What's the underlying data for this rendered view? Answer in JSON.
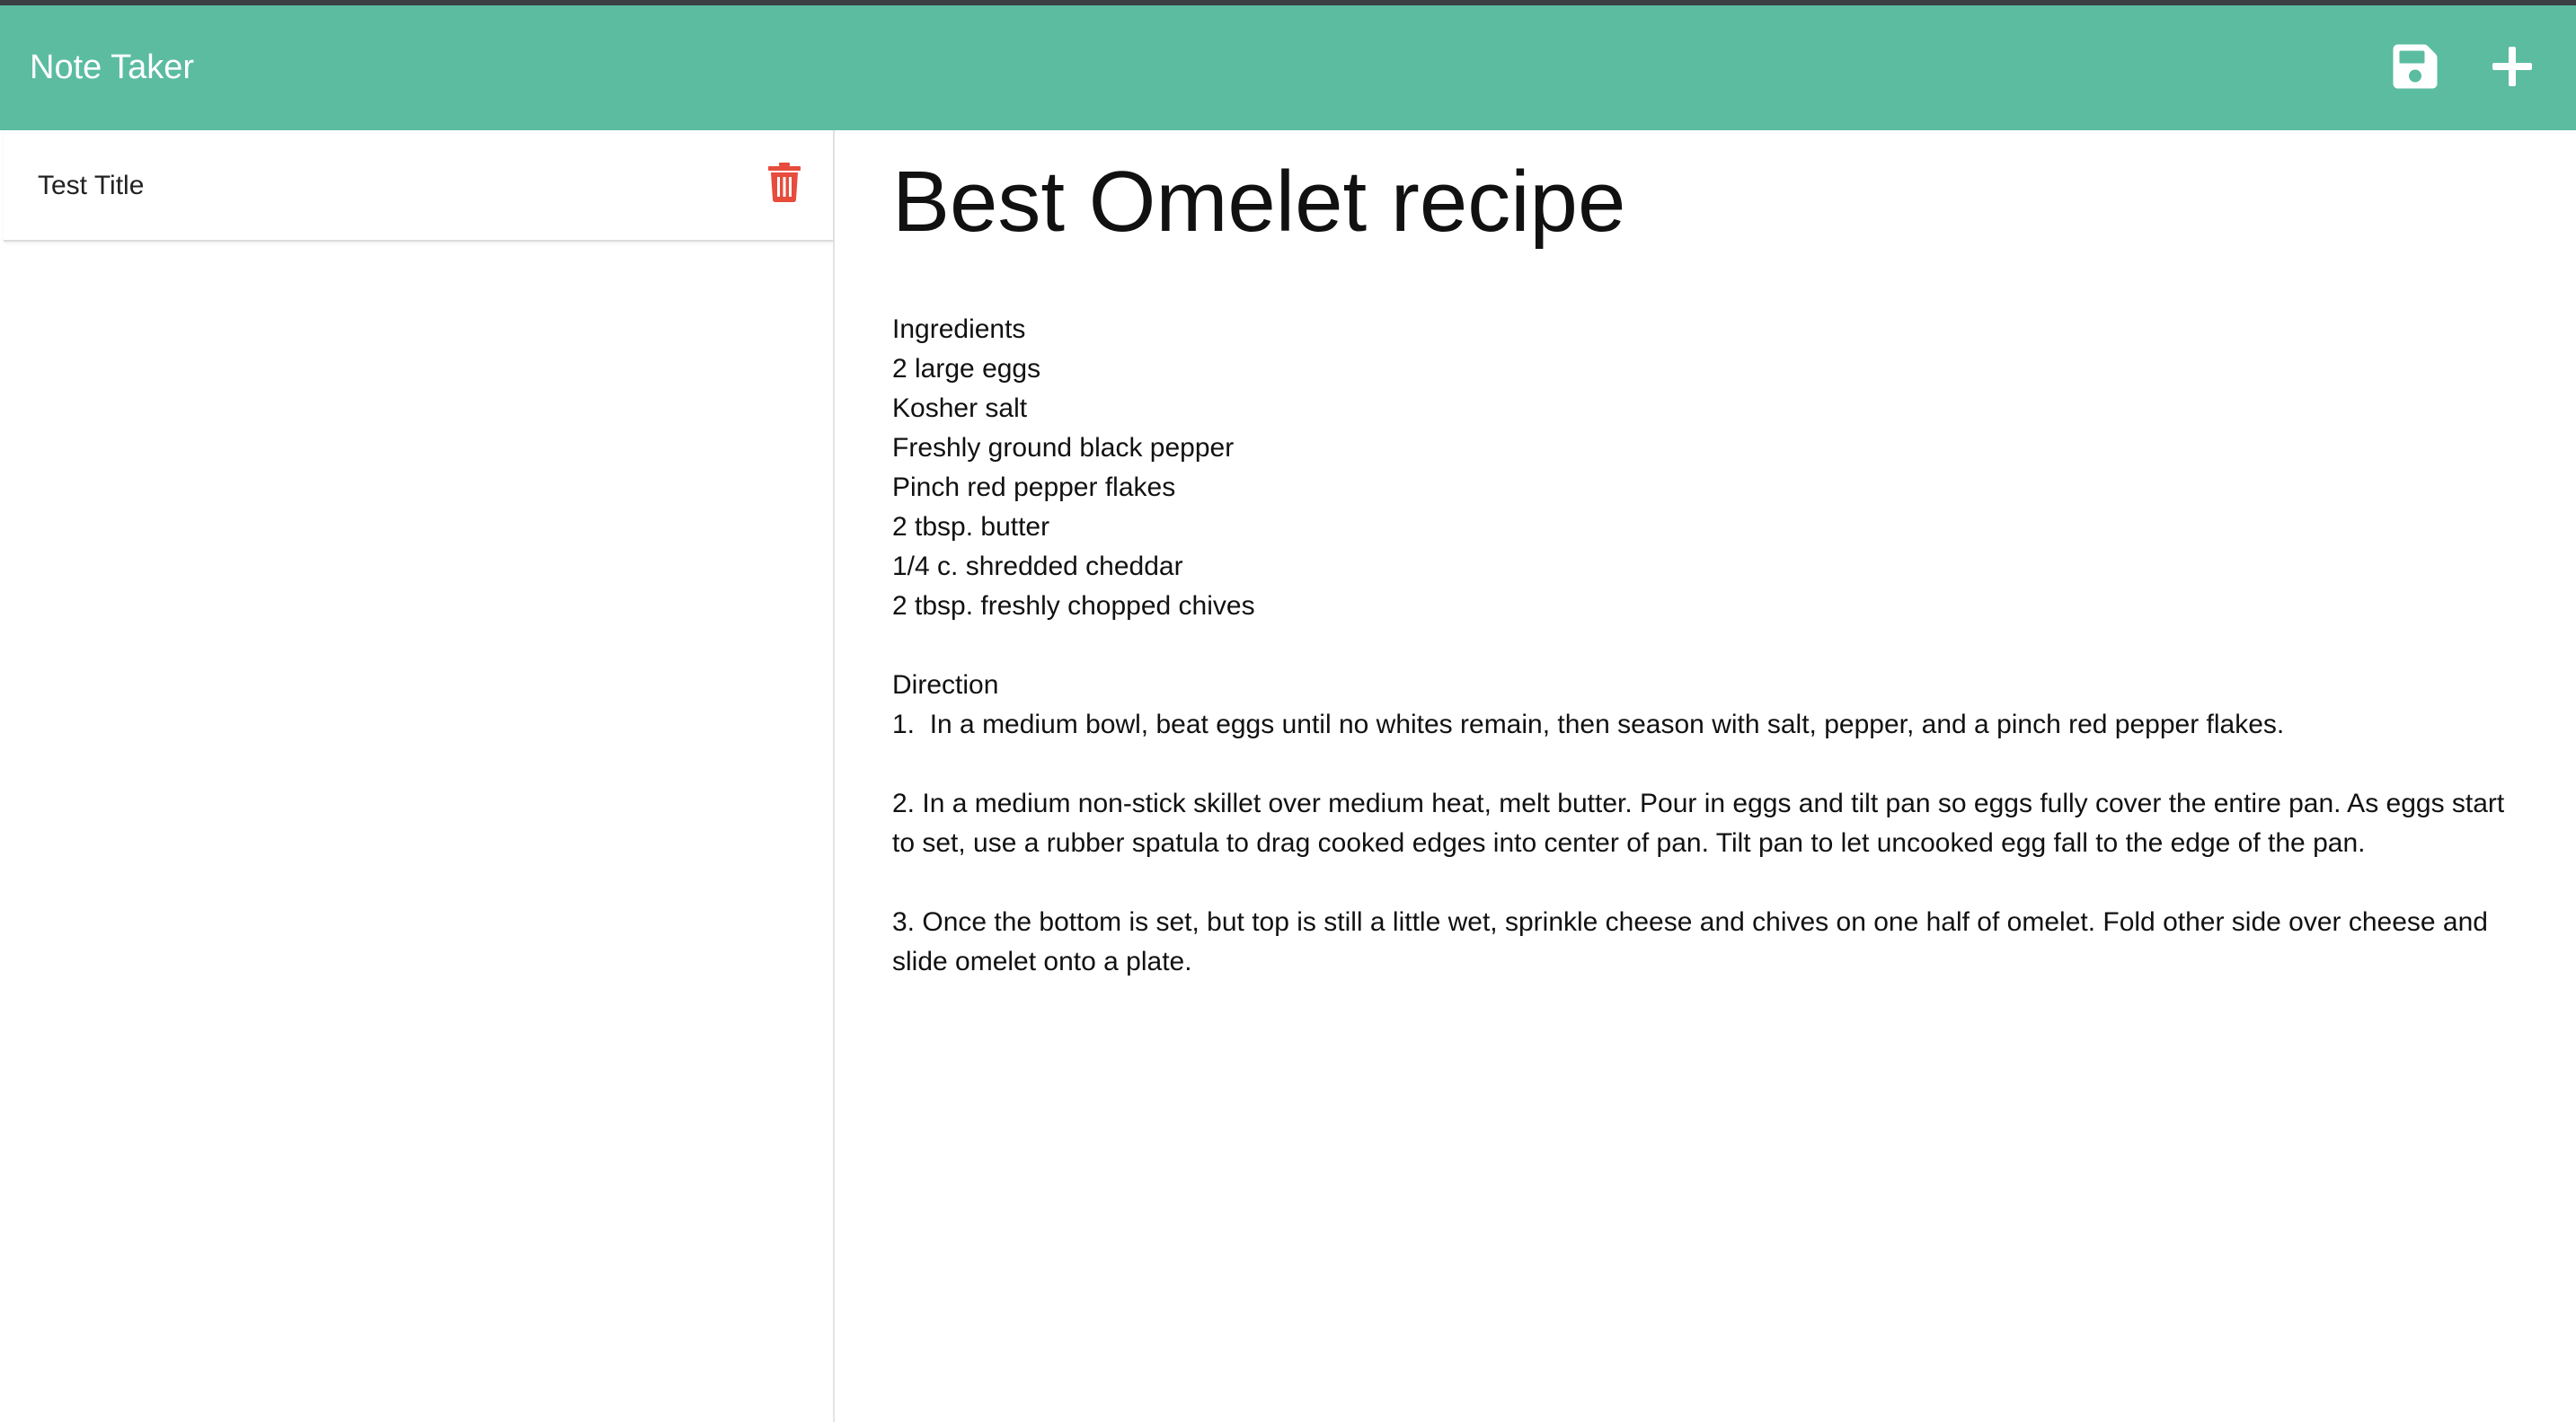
{
  "app": {
    "title": "Note Taker"
  },
  "toolbar": {
    "save_icon": "floppy-disk-icon",
    "new_icon": "plus-icon"
  },
  "sidebar": {
    "notes": [
      {
        "title": "Test Title",
        "delete_icon": "trash-icon"
      }
    ]
  },
  "editor": {
    "title": "Best Omelet recipe",
    "body": "Ingredients\n2 large eggs\nKosher salt\nFreshly ground black pepper\nPinch red pepper flakes\n2 tbsp. butter\n1/4 c. shredded cheddar\n2 tbsp. freshly chopped chives\n\nDirection\n1.  In a medium bowl, beat eggs until no whites remain, then season with salt, pepper, and a pinch red pepper flakes.\n\n2. In a medium non-stick skillet over medium heat, melt butter. Pour in eggs and tilt pan so eggs fully cover the entire pan. As eggs start to set, use a rubber spatula to drag cooked edges into center of pan. Tilt pan to let uncooked egg fall to the edge of the pan.\n\n3. Once the bottom is set, but top is still a little wet, sprinkle cheese and chives on one half of omelet. Fold other side over cheese and slide omelet onto a plate."
  },
  "colors": {
    "navbar": "#5bbca0",
    "delete": "#e74c3c",
    "navbar_text": "#ffffff"
  }
}
